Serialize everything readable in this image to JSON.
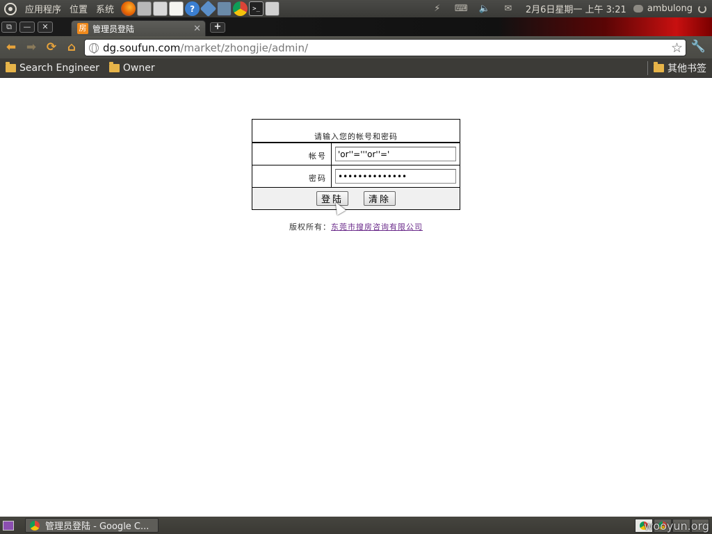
{
  "top_panel": {
    "menus": [
      "应用程序",
      "位置",
      "系统"
    ],
    "clock": "2月6日星期一 上午  3:21",
    "user": "ambulong"
  },
  "window": {
    "tab_title": "管理员登陆",
    "tab_favicon": "房"
  },
  "toolbar": {
    "url_host": "dg.soufun.com",
    "url_path": "/market/zhongjie/admin/"
  },
  "bookmarks": {
    "items": [
      "Search Engineer",
      "Owner"
    ],
    "other": "其他书签"
  },
  "login": {
    "header": "请输入您的帐号和密码",
    "account_label": "帐号",
    "account_value": "'or''='''or''='",
    "password_label": "密码",
    "password_value": "••••••••••••••",
    "login_button": "登陆",
    "clear_button": "清除"
  },
  "footer": {
    "copyright_label": "版权所有：",
    "company": "东莞市搜房咨询有限公司"
  },
  "taskbar": {
    "item": "管理员登陆 - Google C..."
  },
  "watermark": "wooyun.org"
}
